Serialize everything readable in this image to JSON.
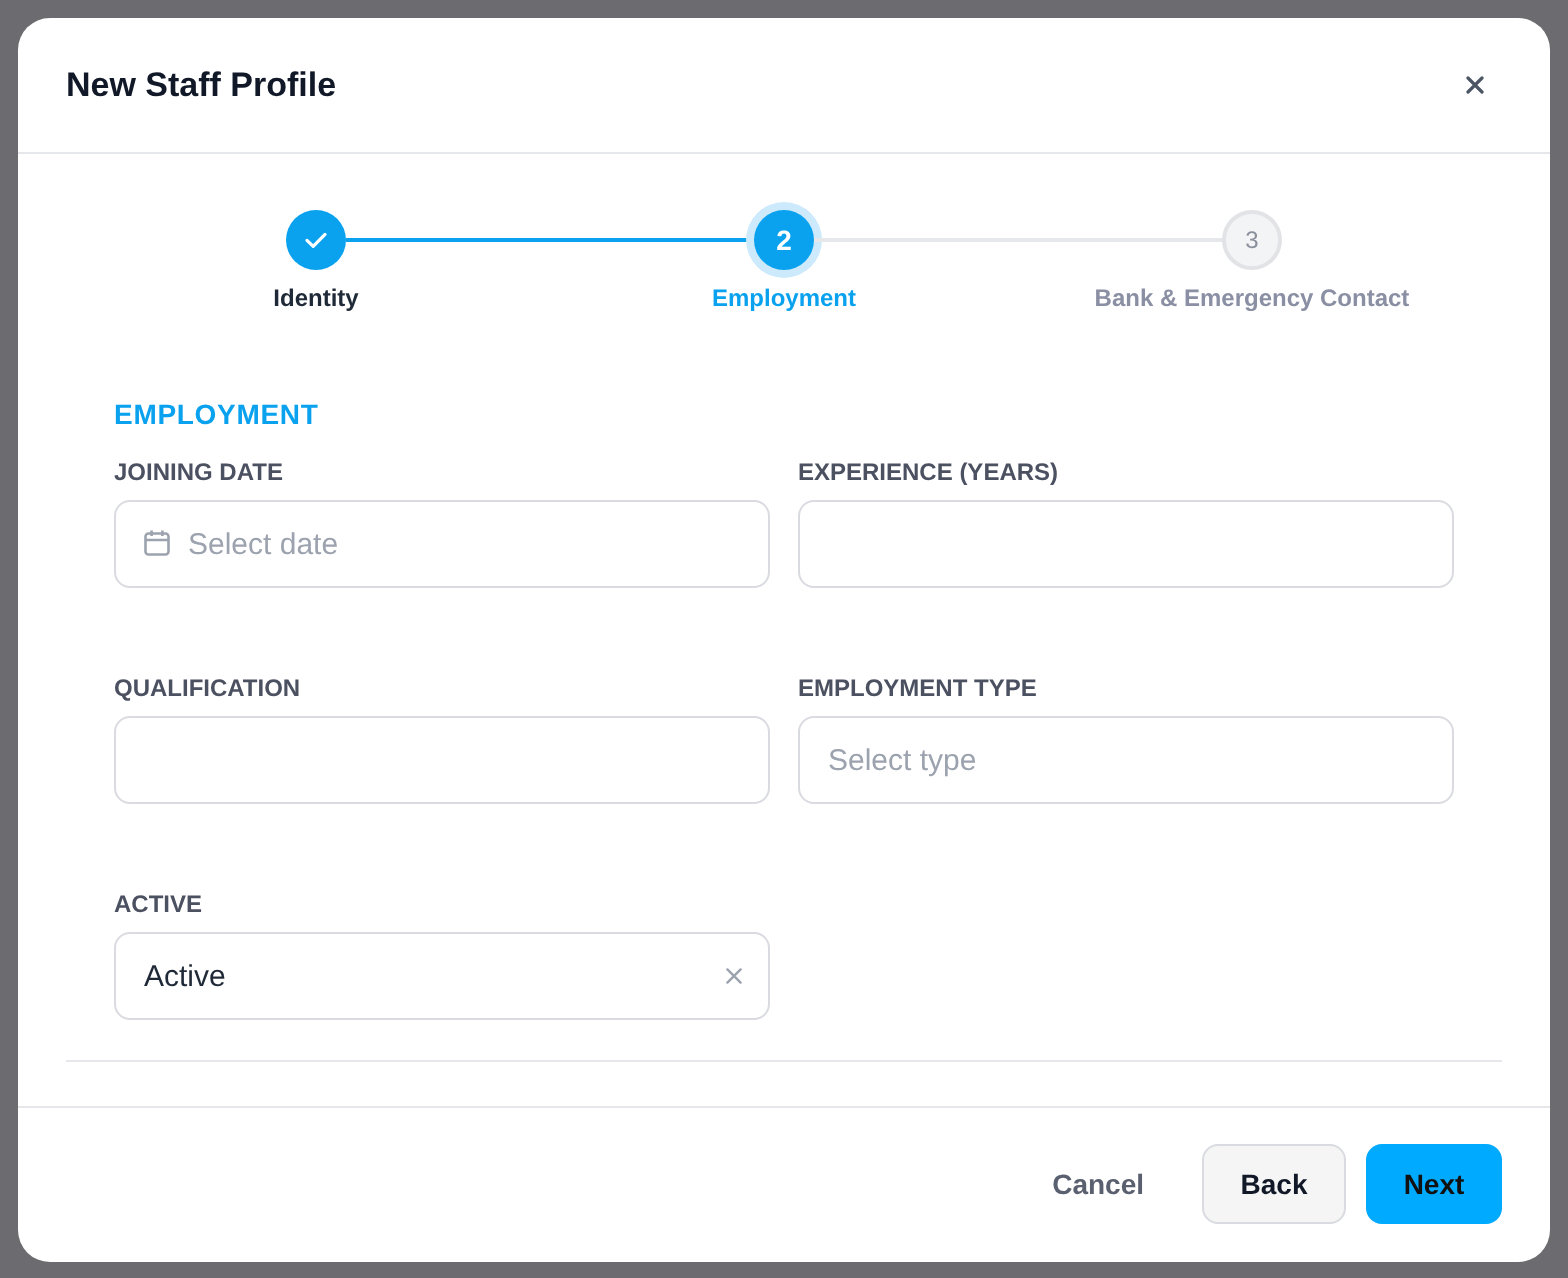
{
  "dialog": {
    "title": "New Staff Profile"
  },
  "steps": [
    {
      "label": "Identity",
      "completed": true,
      "selected": false
    },
    {
      "number": "2",
      "label": "Employment",
      "completed": false,
      "selected": true
    },
    {
      "number": "3",
      "label": "Bank & Emergency Contact",
      "completed": false,
      "selected": false
    }
  ],
  "section": {
    "title": "EMPLOYMENT",
    "fields": [
      {
        "label": "JOINING DATE",
        "kind": "date",
        "placeholder": "Select date"
      },
      {
        "label": "EXPERIENCE (YEARS)",
        "kind": "text"
      },
      {
        "label": "QUALIFICATION",
        "kind": "text"
      },
      {
        "label": "EMPLOYMENT TYPE",
        "kind": "select",
        "placeholder": "Select type"
      },
      {
        "label": "ACTIVE",
        "kind": "select",
        "value": "Active",
        "clearable": true
      }
    ]
  },
  "buttons": [
    {
      "label": "Cancel",
      "kind": "text"
    },
    {
      "label": "Back",
      "kind": "secondary"
    },
    {
      "label": "Next",
      "kind": "primary"
    }
  ]
}
